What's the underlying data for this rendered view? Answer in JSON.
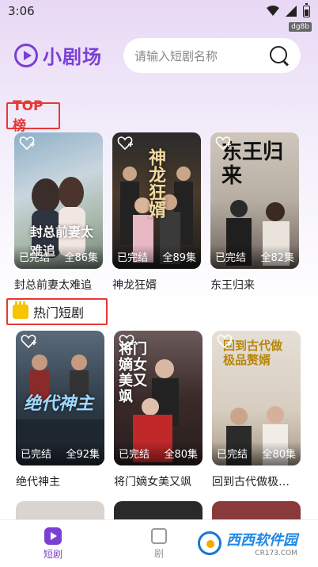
{
  "status_bar": {
    "time": "3:06"
  },
  "debug_tag": "dg8b",
  "header": {
    "app_name": "小剧场",
    "search_placeholder": "请输入短剧名称"
  },
  "top_section": {
    "title": "TOP榜",
    "items": [
      {
        "title": "封总前妻太难追",
        "status": "已完结",
        "episodes": "全86集",
        "poster_text": "封总前妻太难追"
      },
      {
        "title": "神龙狂婿",
        "status": "已完结",
        "episodes": "全89集",
        "poster_text": "神龙狂婿"
      },
      {
        "title": "东王归来",
        "status": "已完结",
        "episodes": "全82集",
        "poster_text": "东王归来"
      }
    ]
  },
  "hot_section": {
    "title": "热门短剧",
    "items": [
      {
        "title": "绝代神主",
        "status": "已完结",
        "episodes": "全92集",
        "poster_text": "绝代神主"
      },
      {
        "title": "将门嫡女美又飒",
        "status": "已完结",
        "episodes": "全80集",
        "poster_text": "将门嫡女美又飒"
      },
      {
        "title": "回到古代做极…",
        "status": "已完结",
        "episodes": "全80集",
        "poster_text": "回到古代做极品赘婿"
      }
    ]
  },
  "bottom_nav": {
    "items": [
      {
        "label": "短剧",
        "active": true
      },
      {
        "label": "剧",
        "active": false
      }
    ]
  },
  "site_watermark": {
    "main": "西西软件园",
    "sub": "CR173.COM"
  },
  "colors": {
    "accent": "#7b3fd6",
    "highlight_border": "#e53935"
  }
}
